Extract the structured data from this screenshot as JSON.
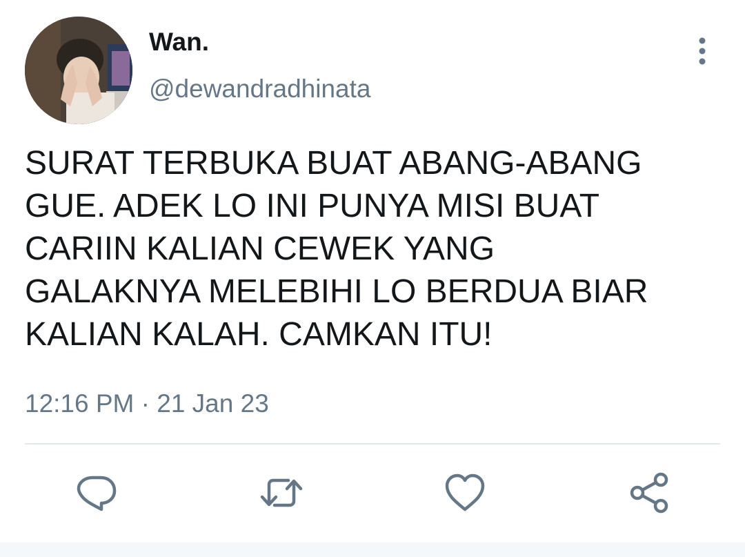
{
  "tweet": {
    "author": {
      "display_name": "Wan.",
      "handle": "@dewandradhinata"
    },
    "text": "SURAT TERBUKA BUAT ABANG-ABANG\nGUE. ADEK LO INI PUNYA MISI BUAT\nCARIIN KALIAN CEWEK YANG\nGALAKNYA MELEBIHI LO BERDUA BIAR\nKALIAN KALAH. CAMKAN ITU!",
    "timestamp": "12:16 PM · 21 Jan 23"
  },
  "icons": {
    "more": "more-vertical-icon",
    "reply": "reply-icon",
    "retweet": "retweet-icon",
    "like": "heart-icon",
    "share": "share-icon"
  },
  "colors": {
    "text": "#14171a",
    "secondary": "#657786",
    "divider": "#e1e8ed",
    "icon": "#657786"
  }
}
